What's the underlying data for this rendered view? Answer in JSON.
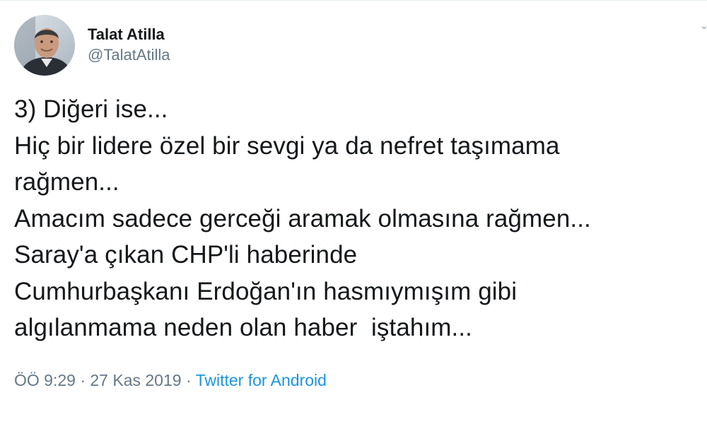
{
  "author": {
    "display_name": "Talat Atilla",
    "handle": "@TalatAtilla",
    "avatar_icon": "profile-photo"
  },
  "tweet": {
    "lines": [
      "3) Diğeri ise...",
      "Hiç bir lidere özel bir sevgi ya da nefret taşımama",
      "rağmen...",
      "Amacım sadece gerceği aramak olmasına rağmen...",
      "Saray'a çıkan CHP'li haberinde",
      "Cumhurbaşkanı Erdoğan'ın hasmıymışım gibi",
      "algılanmama neden olan haber  iştahım..."
    ]
  },
  "meta": {
    "time": "ÖÖ 9:29",
    "separator": " · ",
    "date": "27 Kas 2019",
    "source": "Twitter for Android"
  },
  "colors": {
    "text": "#14171a",
    "secondary": "#657786",
    "link": "#1b95e0",
    "border": "#e6ecf0"
  }
}
